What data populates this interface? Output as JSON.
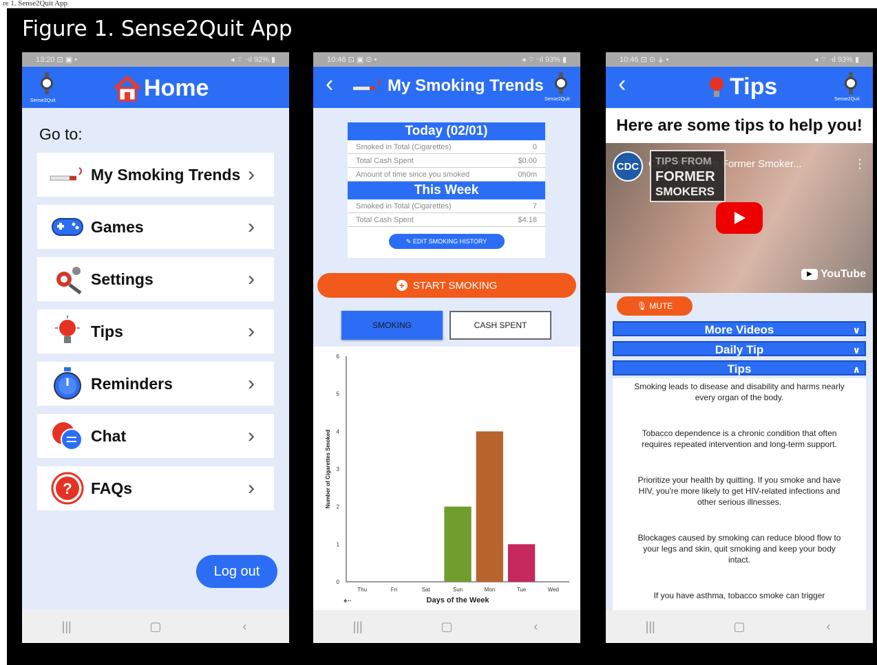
{
  "page_caption": "re 1. Sense2Quit App",
  "figure_title": "Figure 1. Sense2Quit App",
  "brand_label": "Sense2Quit",
  "colors": {
    "primary_blue": "#2b6ef5",
    "orange": "#f25a1c",
    "bg_light": "#e3ebfb",
    "status_gray": "#a9a9a9"
  },
  "phones": {
    "home": {
      "status_time": "13:20 ⊡ ▣ •",
      "status_right": "◂ ⌔ ⋅ıl 92% ▮",
      "title": "Home",
      "goto": "Go to:",
      "menu": [
        {
          "label": "My Smoking Trends",
          "icon": "cigarette-icon"
        },
        {
          "label": "Games",
          "icon": "gamepad-icon"
        },
        {
          "label": "Settings",
          "icon": "settings-gear-icon"
        },
        {
          "label": "Tips",
          "icon": "lightbulb-icon"
        },
        {
          "label": "Reminders",
          "icon": "stopwatch-icon"
        },
        {
          "label": "Chat",
          "icon": "chat-bubbles-icon"
        },
        {
          "label": "FAQs",
          "icon": "question-icon"
        }
      ],
      "logout": "Log out"
    },
    "trends": {
      "status_time": "10:46 ⊡ ▣ ⊙ •",
      "status_right": "◂ ⌔ ⋅ıl 93% ▮",
      "title": "My Smoking Trends",
      "today_header": "Today (02/01)",
      "today_rows": [
        {
          "label": "Smoked in Total (Cigarettes)",
          "value": "0"
        },
        {
          "label": "Total Cash Spent",
          "value": "$0.00"
        },
        {
          "label": "Amount of time since you smoked",
          "value": "0h0m"
        }
      ],
      "week_header": "This Week",
      "week_rows": [
        {
          "label": "Smoked in Total (Cigarettes)",
          "value": "7"
        },
        {
          "label": "Total Cash Spent",
          "value": "$4.18"
        }
      ],
      "edit_history": "EDIT SMOKING HISTORY",
      "start_smoking": "START SMOKING",
      "toggle_smoking": "SMOKING",
      "toggle_cash": "CASH SPENT"
    },
    "tips": {
      "status_time": "10:46 ⊡ ⊙ ⚶ •",
      "status_right": "◂ ⌔ ⋅ıl 93% ▮",
      "title": "Tips",
      "heading": "Here are some tips to help you!",
      "video_channel": "CDC",
      "video_title": "CDC: Tips from Former Smoker...",
      "video_overlay_line1": "TIPS FROM",
      "video_overlay_line2": "FORMER",
      "video_overlay_line3": "SMOKERS",
      "youtube_label": "YouTube",
      "mute": "MUTE",
      "sections": [
        "More Videos",
        "Daily Tip",
        "Tips"
      ],
      "tips_list": [
        "Smoking leads to disease and disability and harms nearly every organ of the body.",
        "Tobacco dependence is a chronic condition that often requires repeated intervention and long-term support.",
        "Prioritize your health by quitting. If you smoke and have HIV, you're more likely to get HIV-related infections and other serious illnesses.",
        "Blockages caused by smoking can reduce blood flow to your legs and skin, quit smoking and keep your body intact.",
        "If you have asthma, tobacco smoke can trigger"
      ]
    }
  },
  "chart_data": {
    "type": "bar",
    "categories": [
      "Thu",
      "Fri",
      "Sat",
      "Sun",
      "Mon",
      "Tue",
      "Wed"
    ],
    "values": [
      0,
      0,
      0,
      2,
      4,
      1,
      0
    ],
    "bar_colors": [
      "#3f7fd6",
      "#3f7fd6",
      "#3f7fd6",
      "#6f9e2e",
      "#b8642c",
      "#c4285c",
      "#3f7fd6"
    ],
    "xlabel": "Days of the Week",
    "ylabel": "Number of Cigarettes Smoked",
    "ylim": [
      0,
      6
    ],
    "yticks": [
      "0",
      "1",
      "2",
      "3",
      "4",
      "5",
      "6"
    ],
    "grid": false
  }
}
